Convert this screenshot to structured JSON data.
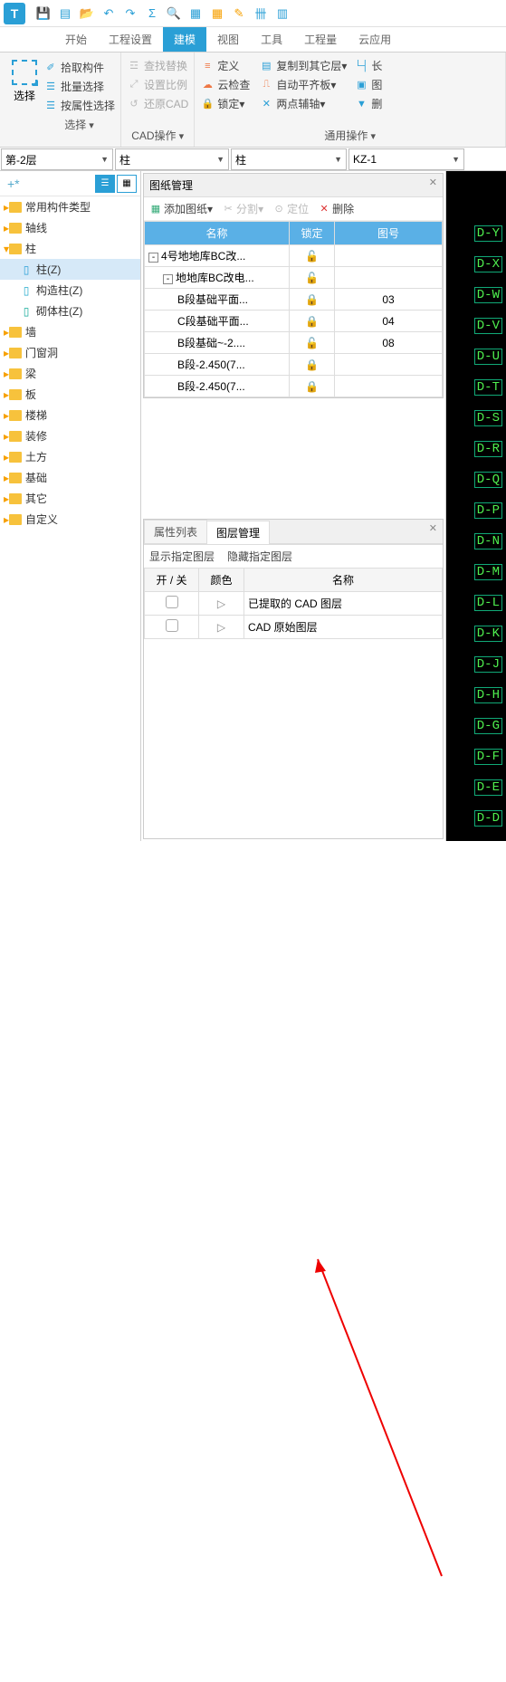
{
  "titlebar": {
    "logo": "T"
  },
  "tabs": [
    "开始",
    "工程设置",
    "建模",
    "视图",
    "工具",
    "工程量",
    "云应用"
  ],
  "ribbon": {
    "select": {
      "big": "选择",
      "items": [
        "拾取构件",
        "批量选择",
        "按属性选择"
      ],
      "footer": "选择"
    },
    "cad": {
      "items": [
        "查找替换",
        "设置比例",
        "还原CAD"
      ],
      "footer": "CAD操作"
    },
    "ops": {
      "col1": [
        "定义",
        "云检查",
        "锁定"
      ],
      "col2": [
        "复制到其它层",
        "自动平齐板",
        "两点辅轴"
      ],
      "footer": "通用操作"
    }
  },
  "dropdowns": {
    "floor": "第-2层",
    "cat": "柱",
    "sub": "柱",
    "memb": "KZ-1"
  },
  "tree": {
    "items": [
      {
        "label": "常用构件类型",
        "lvl": 0
      },
      {
        "label": "轴线",
        "lvl": 0
      },
      {
        "label": "柱",
        "lvl": 0,
        "open": true
      },
      {
        "label": "柱(Z)",
        "lvl": 1,
        "sel": true,
        "icon": "col-blue"
      },
      {
        "label": "构造柱(Z)",
        "lvl": 1,
        "icon": "col-cyan"
      },
      {
        "label": "砌体柱(Z)",
        "lvl": 1,
        "icon": "col-teal"
      },
      {
        "label": "墙",
        "lvl": 0
      },
      {
        "label": "门窗洞",
        "lvl": 0
      },
      {
        "label": "梁",
        "lvl": 0
      },
      {
        "label": "板",
        "lvl": 0
      },
      {
        "label": "楼梯",
        "lvl": 0
      },
      {
        "label": "装修",
        "lvl": 0
      },
      {
        "label": "土方",
        "lvl": 0
      },
      {
        "label": "基础",
        "lvl": 0
      },
      {
        "label": "其它",
        "lvl": 0
      },
      {
        "label": "自定义",
        "lvl": 0
      }
    ]
  },
  "drawings": {
    "title": "图纸管理",
    "toolbar": {
      "add": "添加图纸",
      "split": "分割",
      "locate": "定位",
      "delete": "删除"
    },
    "headers": {
      "name": "名称",
      "lock": "锁定",
      "num": "图号"
    },
    "rows": [
      {
        "indent": 0,
        "exp": "-",
        "name": "4号地地库BC改...",
        "lock": "open",
        "num": ""
      },
      {
        "indent": 1,
        "exp": "-",
        "name": "地地库BC改电...",
        "lock": "open",
        "num": ""
      },
      {
        "indent": 2,
        "name": "B段基础平面...",
        "lock": "closed",
        "num": "03"
      },
      {
        "indent": 2,
        "name": "C段基础平面...",
        "lock": "closed",
        "num": "04"
      },
      {
        "indent": 2,
        "name": "B段基础~-2....",
        "lock": "open",
        "num": "08",
        "hl": true
      },
      {
        "indent": 2,
        "name": "B段-2.450(7...",
        "lock": "closed",
        "num": ""
      },
      {
        "indent": 2,
        "name": "B段-2.450(7...",
        "lock": "closed",
        "num": ""
      }
    ]
  },
  "layers": {
    "tabs": [
      "属性列表",
      "图层管理"
    ],
    "opts": [
      "显示指定图层",
      "隐藏指定图层"
    ],
    "headers": {
      "sw": "开 / 关",
      "color": "颜色",
      "name": "名称"
    },
    "rows": [
      {
        "name": "已提取的 CAD 图层"
      },
      {
        "name": "CAD 原始图层"
      }
    ]
  },
  "marks": [
    "D-Y",
    "D-X",
    "D-W",
    "D-V",
    "D-U",
    "D-T",
    "D-S",
    "D-R",
    "D-Q",
    "D-P",
    "D-N",
    "D-M",
    "D-L",
    "D-K",
    "D-J",
    "D-H",
    "D-G",
    "D-F",
    "D-E",
    "D-D"
  ]
}
